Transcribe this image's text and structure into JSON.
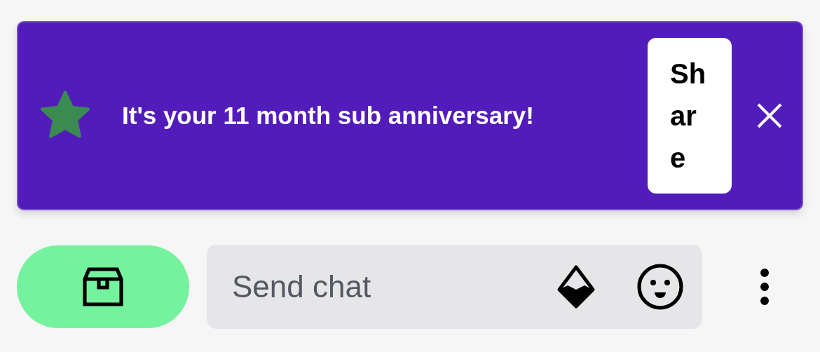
{
  "banner": {
    "message": "It's your 11 month sub anniversary!",
    "share_button": "Share"
  },
  "chat_input": {
    "placeholder": "Send chat"
  }
}
